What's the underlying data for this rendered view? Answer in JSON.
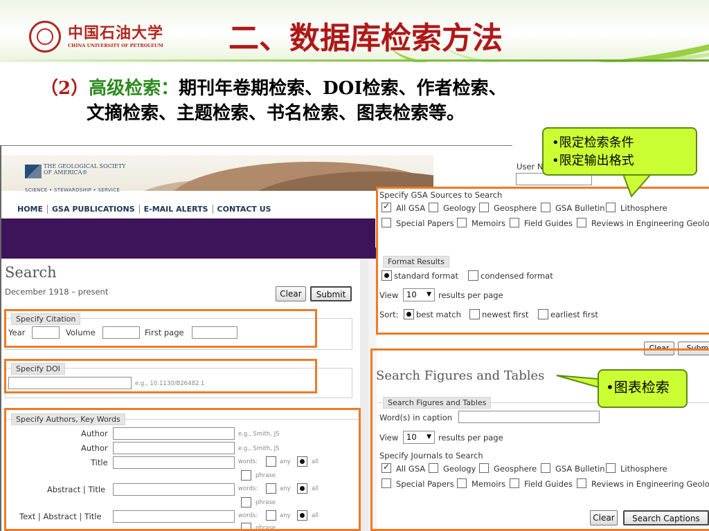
{
  "slide": {
    "logo_cn": "中国石油大学",
    "logo_en": "CHINA UNIVERSITY OF PETROLEUM",
    "title": "二、数据库检索方法",
    "line1_prefix": "（2）",
    "line1_highlight": "高级检索：",
    "line1_rest": "期刊年卷期检索、DOI检索、作者检索、",
    "line2": "文摘检索、主题检索、书名检索、图表检索等。"
  },
  "callouts": {
    "top_line1": "•限定检索条件",
    "top_line2": "•限定输出格式",
    "right": "•图表检索"
  },
  "gsa": {
    "org_name": "THE GEOLOGICAL SOCIETY OF AMERICA®",
    "tagline": "SCIENCE • STEWARDSHIP • SERVICE",
    "nav": [
      "HOME",
      "GSA PUBLICATIONS",
      "E-MAIL ALERTS",
      "CONTACT US"
    ],
    "user_label": "User Na"
  },
  "search": {
    "title": "Search",
    "date_range": "December 1918 – present",
    "clear": "Clear",
    "submit": "Submit",
    "citation_legend": "Specify Citation",
    "year": "Year",
    "volume": "Volume",
    "first_page": "First page",
    "doi_legend": "Specify DOI",
    "doi_hint": "e.g., 10.1130/B26482.1",
    "authors_legend": "Specify Authors, Key Words",
    "author1": "Author",
    "author1_hint": "e.g., Smith, JS",
    "author2": "Author",
    "author2_hint": "e.g., Smith, JS",
    "title_lbl": "Title",
    "abstract_title": "Abstract | Title",
    "text_abstract_title": "Text | Abstract | Title",
    "words": "words:",
    "any": "any",
    "all": "all",
    "phrase": "phrase"
  },
  "sources": {
    "legend": "Specify GSA Sources to Search",
    "row1": [
      "All GSA",
      "Geology",
      "Geosphere",
      "GSA Bulletin",
      "Lithosphere"
    ],
    "row2": [
      "Special Papers",
      "Memoirs",
      "Field Guides",
      "Reviews in Engineering Geology"
    ],
    "checked": "All GSA"
  },
  "format": {
    "legend": "Format Results",
    "standard": "standard format",
    "condensed": "condensed format",
    "view": "View",
    "view_value": "10",
    "per_page": "results per page",
    "sort": "Sort:",
    "best": "best match",
    "newest": "newest first",
    "earliest": "earliest first",
    "clear": "Clear",
    "submit": "Submi"
  },
  "figures": {
    "title": "Search Figures and Tables",
    "legend": "Search Figures and Tables",
    "caption_lbl": "Word(s) in caption",
    "view": "View",
    "view_value": "10",
    "per_page": "results per page",
    "journals_lbl": "Specify Journals to Search",
    "row1": [
      "All GSA",
      "Geology",
      "Geosphere",
      "GSA Bulletin",
      "Lithosphere"
    ],
    "row2": [
      "Special Papers",
      "Memoirs",
      "Field Guides",
      "Reviews in Engineering Geology"
    ],
    "clear": "Clear",
    "search_captions": "Search Captions"
  }
}
